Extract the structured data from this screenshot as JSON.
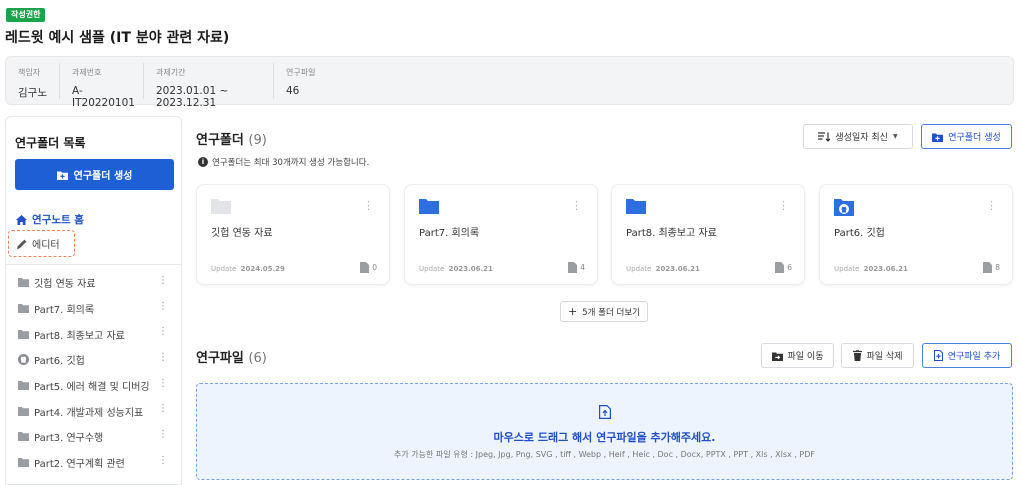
{
  "header": {
    "badge": "작성권한",
    "title": "레드윗 예시 샘플 (IT 분야 관련 자료)"
  },
  "info": [
    {
      "label": "책임자",
      "value": "김구노"
    },
    {
      "label": "과제번호",
      "value": "A-IT20220101"
    },
    {
      "label": "과제기간",
      "value": "2023.01.01 ~ 2023.12.31"
    },
    {
      "label": "연구파일",
      "value": "46"
    }
  ],
  "sidebar": {
    "title": "연구폴더 목록",
    "create_label": "연구폴더 생성",
    "home_label": "연구노트 홈",
    "editor_label": "에디터",
    "items": [
      {
        "label": "깃헙 연동 자료",
        "icon": "folder-icon"
      },
      {
        "label": "Part7. 회의록",
        "icon": "folder-icon"
      },
      {
        "label": "Part8. 최종보고 자료",
        "icon": "folder-icon"
      },
      {
        "label": "Part6. 깃헙",
        "icon": "github-icon"
      },
      {
        "label": "Part5. 에러 해결 및 디버깅",
        "icon": "folder-icon"
      },
      {
        "label": "Part4. 개발과제 성능지표",
        "icon": "folder-icon"
      },
      {
        "label": "Part3. 연구수행",
        "icon": "folder-icon"
      },
      {
        "label": "Part2. 연구계획 관련",
        "icon": "folder-icon"
      }
    ]
  },
  "folders": {
    "title": "연구폴더",
    "count": "(9)",
    "notice": "연구폴더는 최대 30개까지 생성 가능합니다.",
    "sort_label": "생성일자 최신",
    "create_label": "연구폴더 생성",
    "more_label": "5개 폴더 더보기",
    "update_prefix": "Update",
    "cards": [
      {
        "name": "깃헙 연동 자료",
        "date": "2024.05.29",
        "files": "0",
        "icon": "folder-gray-icon"
      },
      {
        "name": "Part7. 회의록",
        "date": "2023.06.21",
        "files": "4",
        "icon": "folder-blue-icon"
      },
      {
        "name": "Part8. 최종보고 자료",
        "date": "2023.06.21",
        "files": "6",
        "icon": "folder-blue-icon"
      },
      {
        "name": "Part6. 깃헙",
        "date": "2023.06.21",
        "files": "8",
        "icon": "github-folder-icon"
      }
    ]
  },
  "files": {
    "title": "연구파일",
    "count": "(6)",
    "move_label": "파일 이동",
    "delete_label": "파일 삭제",
    "add_label": "연구파일 추가",
    "drop_main": "마우스로 드래그 해서 연구파일을 추가해주세요.",
    "drop_sub": "추가 가능한 파일 유형 : Jpeg, Jpg, Png, SVG , tiff , Webp , Heif , Heic , Doc , Docx, PPTX , PPT , Xls , Xlsx , PDF"
  },
  "colors": {
    "accent": "#1f5fd6",
    "badge": "#1aa34a",
    "folder_blue": "#2d6fe0",
    "folder_gray": "#e2e4e7"
  }
}
